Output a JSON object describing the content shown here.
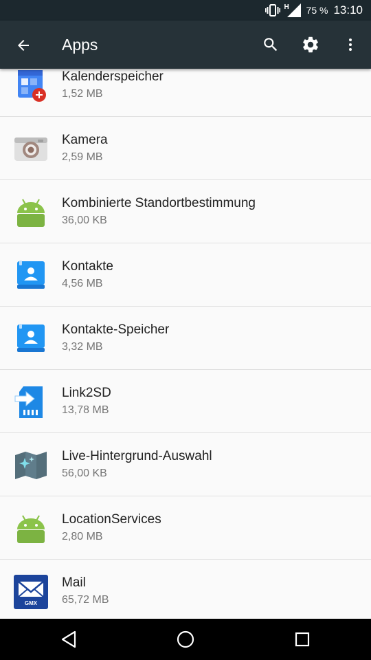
{
  "status_bar": {
    "network_type": "H",
    "battery": "75 %",
    "time": "13:10",
    "icons": [
      "vibrate-icon",
      "signal-icon"
    ]
  },
  "app_bar": {
    "title": "Apps",
    "background": "#263238",
    "actions": [
      "search-icon",
      "settings-gear-icon",
      "more-vert-icon"
    ]
  },
  "apps": [
    {
      "name": "Kalenderspeicher",
      "size": "1,52 MB",
      "icon": "calendar-storage-icon"
    },
    {
      "name": "Kamera",
      "size": "2,59 MB",
      "icon": "camera-icon"
    },
    {
      "name": "Kombinierte Standortbestimmung",
      "size": "36,00 KB",
      "icon": "android-icon"
    },
    {
      "name": "Kontakte",
      "size": "4,56 MB",
      "icon": "contacts-icon"
    },
    {
      "name": "Kontakte-Speicher",
      "size": "3,32 MB",
      "icon": "contacts-storage-icon"
    },
    {
      "name": "Link2SD",
      "size": "13,78 MB",
      "icon": "sd-card-icon"
    },
    {
      "name": "Live-Hintergrund-Auswahl",
      "size": "56,00 KB",
      "icon": "live-wallpaper-map-icon"
    },
    {
      "name": "LocationServices",
      "size": "2,80 MB",
      "icon": "android-icon"
    },
    {
      "name": "Mail",
      "size": "65,72 MB",
      "icon": "gmx-mail-icon",
      "icon_label": "GMX"
    }
  ],
  "nav_bar": [
    "back-triangle-icon",
    "home-circle-icon",
    "recents-square-icon"
  ]
}
